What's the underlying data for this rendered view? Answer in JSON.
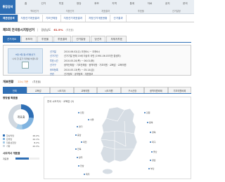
{
  "top_nav": {
    "logo": "통합검색",
    "menu": [
      "홈",
      "선거",
      "투표",
      "정당",
      "후보",
      "지역",
      "통계",
      "자료",
      "공지",
      "문의"
    ],
    "sub": [
      "역대선거",
      "지방선거",
      "개표결과",
      "투표율",
      "선거일정"
    ]
  },
  "tabs2": [
    "제관련검색",
    "지방선거개표결과",
    "기초단체장",
    "지방선거개표결과",
    "지방선거개표현황",
    "선거결과"
  ],
  "title": {
    "name": "제5회 전국동시지방선거",
    "turn": "경상남도",
    "pct": "61.9%",
    "small": "(투표율)"
  },
  "tabs3": [
    "선거개요",
    "후보자",
    "투표율",
    "투표결과",
    "선거일정",
    "당선자",
    "부재자투표"
  ],
  "info": {
    "img_line1": "6월 2일 동시지방선거",
    "img_line2": "나의 한 표가 미래를 바꿉니다",
    "lines": [
      {
        "label": "선거일",
        "value": "2010.06.02(수) 오전6시 ~ 오후6시"
      },
      {
        "label": "선거기간",
        "value": "선거기일 현재 19세 이상의 국민 (1991.06.03이전 출생자)"
      },
      {
        "label": "투표시간",
        "value": "2010.05.20(목) ~ 06.01(화)"
      },
      {
        "label": "선거구",
        "value": "광역단체장 · 기초단체장 · 광역의원 · 기초의원 · 교육감 · 교육의원"
      },
      {
        "label": "후보등록",
        "value": "2010.05.13(목) ~ 05.14(금)"
      },
      {
        "label": "관련",
        "value": "선거정보 · 공약정보 · 개표정보"
      }
    ]
  },
  "sec_head": {
    "title": "개표현황",
    "sub": "22시 기준",
    "sub2": "(투표율)"
  },
  "region_tabs": [
    "전체",
    "교육감",
    "시도지사",
    "교육의원",
    "시도의원",
    "구시군장",
    "광역의원비례",
    "기초의원비례"
  ],
  "left_panel": {
    "title": "정당별 득표율",
    "center": "개표중",
    "legend": [
      {
        "name": "한나라당",
        "pct": "26.4%",
        "color": "#2f6fb5"
      },
      {
        "name": "민주당",
        "pct": "22.1%",
        "color": "#7fb3e0"
      },
      {
        "name": "자유선진당",
        "pct": "8.2%",
        "color": "#a8cde8"
      },
      {
        "name": "기타",
        "pct": "43.3%",
        "color": "#d0d8e0"
      }
    ],
    "title2": "시도지사 개표율",
    "bars": [
      {
        "name": "개표율",
        "pct": 0.57
      }
    ]
  },
  "map": {
    "head": "전국 시도지사 · 교육감 (2)",
    "labels": [
      {
        "text": "인천"
      },
      {
        "text": "서울"
      },
      {
        "text": "경기"
      },
      {
        "text": "강원"
      },
      {
        "text": "충북"
      },
      {
        "text": "충남"
      },
      {
        "text": "대전"
      },
      {
        "text": "경북"
      },
      {
        "text": "전북"
      },
      {
        "text": "대구"
      },
      {
        "text": "울산"
      },
      {
        "text": "광주"
      },
      {
        "text": "경남"
      },
      {
        "text": "부산"
      },
      {
        "text": "전남"
      },
      {
        "text": "제주"
      }
    ]
  }
}
